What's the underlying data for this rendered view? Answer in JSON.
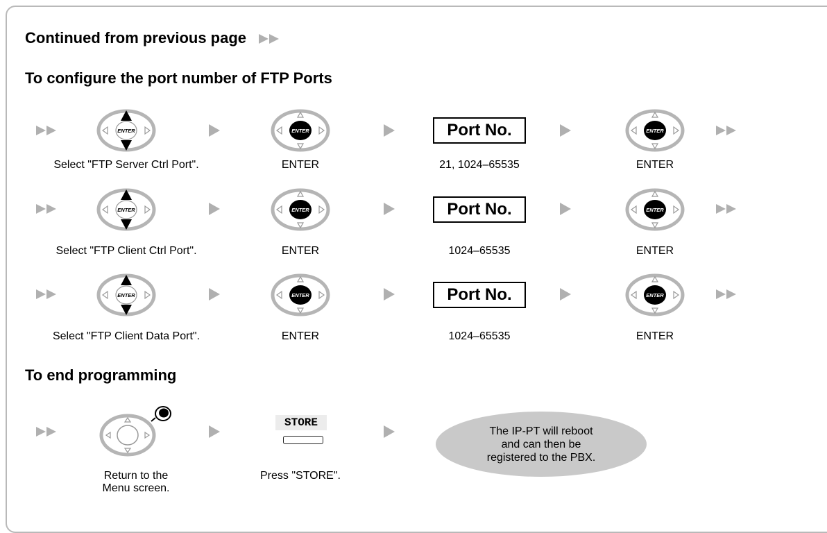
{
  "headings": {
    "continued": "Continued from previous page",
    "configure": "To configure the port number of FTP Ports",
    "end": "To end programming"
  },
  "rows": [
    {
      "select_caption": "Select \"FTP Server Ctrl Port\".",
      "enter1_caption": "ENTER",
      "port_label": "Port No.",
      "port_range": "21, 1024–65535",
      "enter2_caption": "ENTER"
    },
    {
      "select_caption": "Select \"FTP Client Ctrl Port\".",
      "enter1_caption": "ENTER",
      "port_label": "Port No.",
      "port_range": "1024–65535",
      "enter2_caption": "ENTER"
    },
    {
      "select_caption": "Select \"FTP Client Data Port\".",
      "enter1_caption": "ENTER",
      "port_label": "Port No.",
      "port_range": "1024–65535",
      "enter2_caption": "ENTER"
    }
  ],
  "end": {
    "return_caption": "Return to the\nMenu screen.",
    "store_key_label": "STORE",
    "store_caption": "Press \"STORE\".",
    "bubble_text": "The IP-PT will reboot\nand can then be\nregistered to the PBX."
  },
  "dial_center_label": "ENTER",
  "icons": [
    "double-arrow-icon",
    "single-arrow-icon",
    "navigator-dial-icon",
    "enter-dial-icon",
    "store-key-icon"
  ],
  "colors": {
    "arrow": "#b0b0b0",
    "dial_ring": "#b5b5b5",
    "bubble": "#c9c9c9",
    "frame": "#b9b9b9"
  }
}
